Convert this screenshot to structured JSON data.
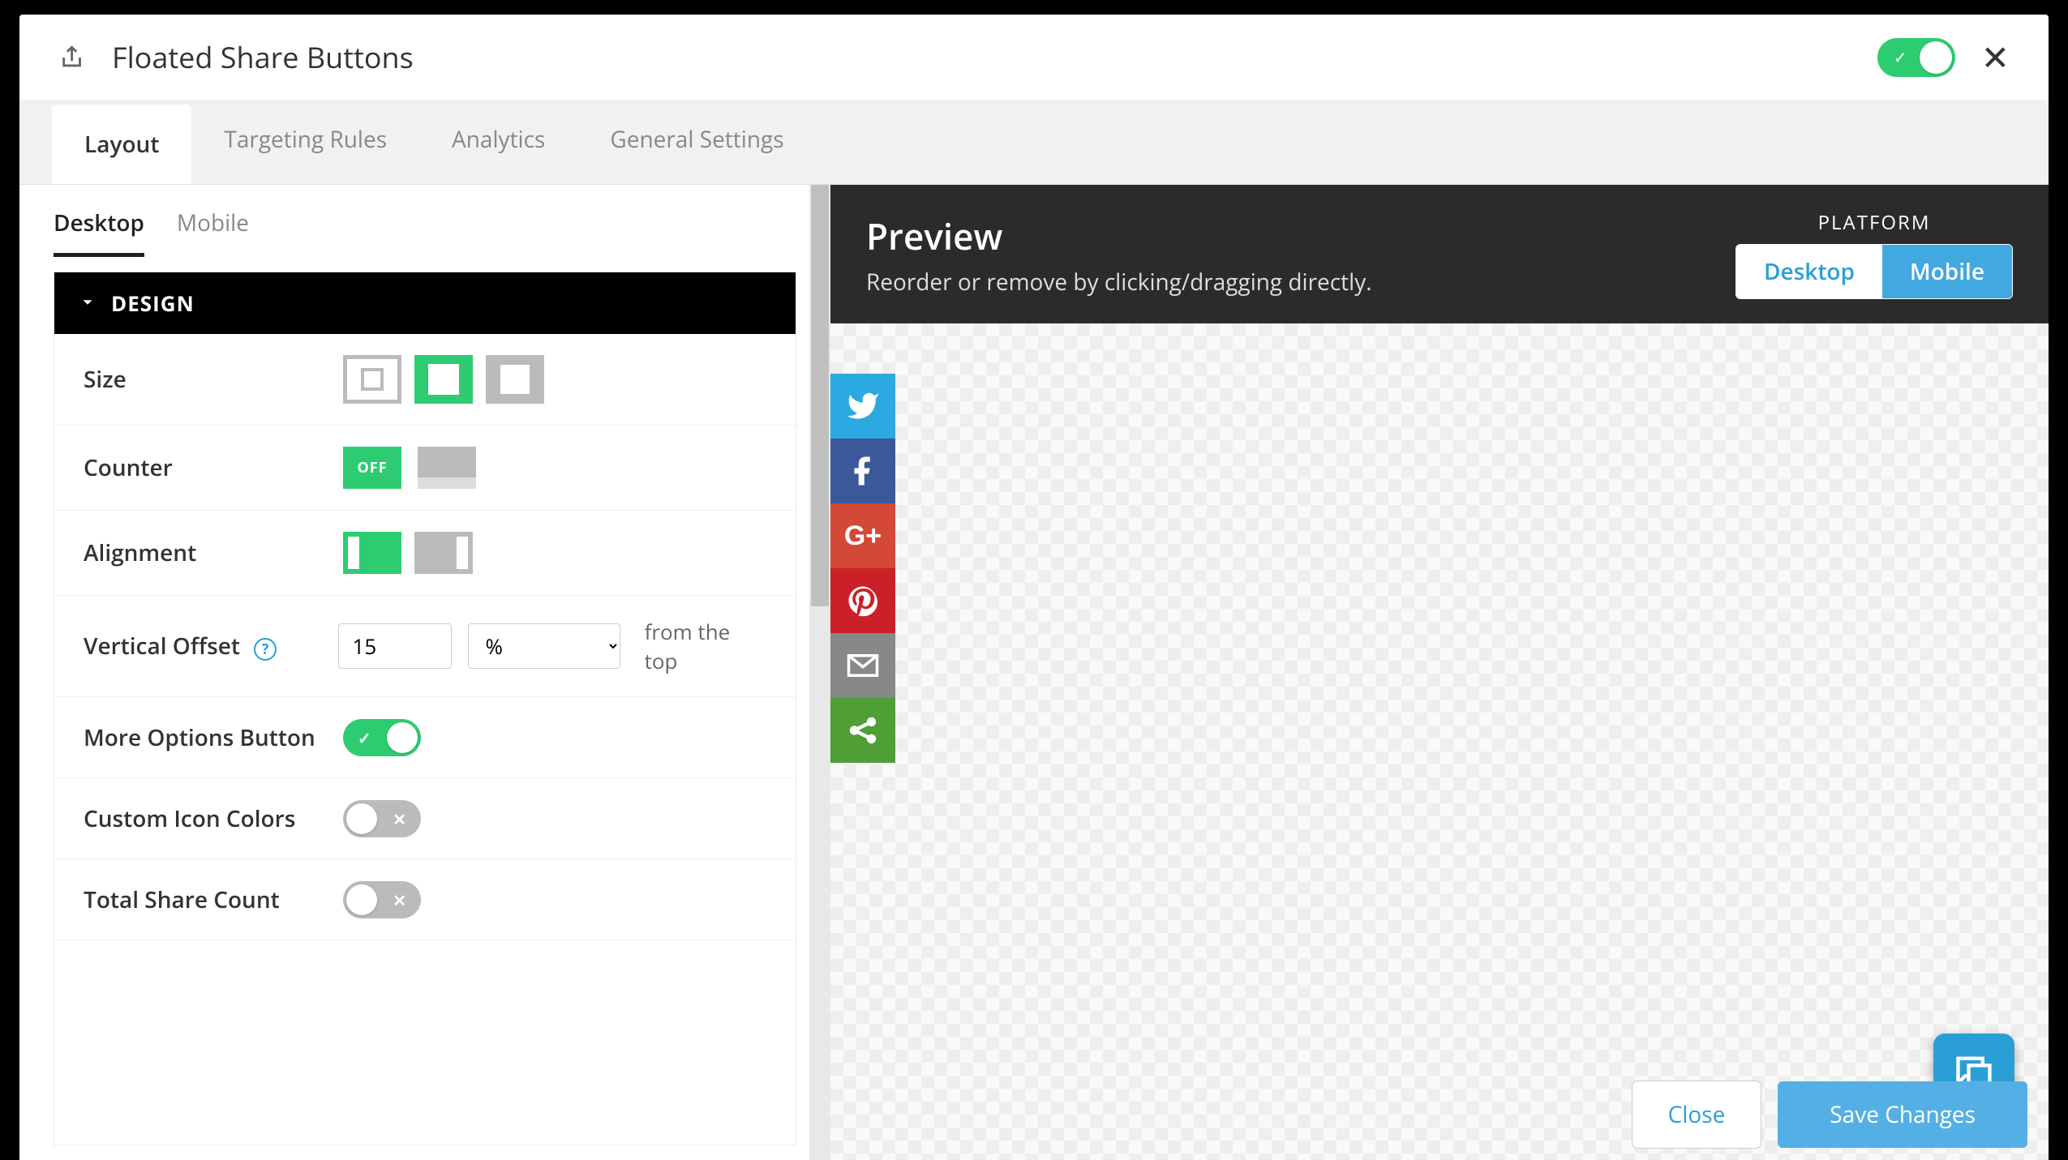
{
  "title": "Floated Share Buttons",
  "enabled": true,
  "tabs": [
    "Layout",
    "Targeting Rules",
    "Analytics",
    "General Settings"
  ],
  "activeTab": "Layout",
  "subtabs": [
    "Desktop",
    "Mobile"
  ],
  "activeSubtab": "Desktop",
  "section": "DESIGN",
  "labels": {
    "size": "Size",
    "counter": "Counter",
    "alignment": "Alignment",
    "verticalOffset": "Vertical Offset",
    "moreOptions": "More Options Button",
    "customColors": "Custom Icon Colors",
    "totalShare": "Total Share Count",
    "fromTop": "from the top",
    "counterOff": "OFF"
  },
  "values": {
    "sizeSelected": 1,
    "counterSelected": 0,
    "alignSelected": 0,
    "verticalOffset": "15",
    "verticalUnit": "%",
    "moreOptions": true,
    "customColors": false,
    "totalShare": false
  },
  "unitOptions": [
    "%"
  ],
  "preview": {
    "title": "Preview",
    "subtitle": "Reorder or remove by clicking/dragging directly.",
    "platformLabel": "PLATFORM",
    "desktop": "Desktop",
    "mobile": "Mobile",
    "activePlatform": "Mobile"
  },
  "shareButtons": [
    {
      "name": "twitter",
      "class": "tw"
    },
    {
      "name": "facebook",
      "class": "fb"
    },
    {
      "name": "google-plus",
      "class": "gp"
    },
    {
      "name": "pinterest",
      "class": "pn"
    },
    {
      "name": "email",
      "class": "em"
    },
    {
      "name": "more",
      "class": "mo"
    }
  ],
  "footer": {
    "close": "Close",
    "save": "Save Changes"
  }
}
